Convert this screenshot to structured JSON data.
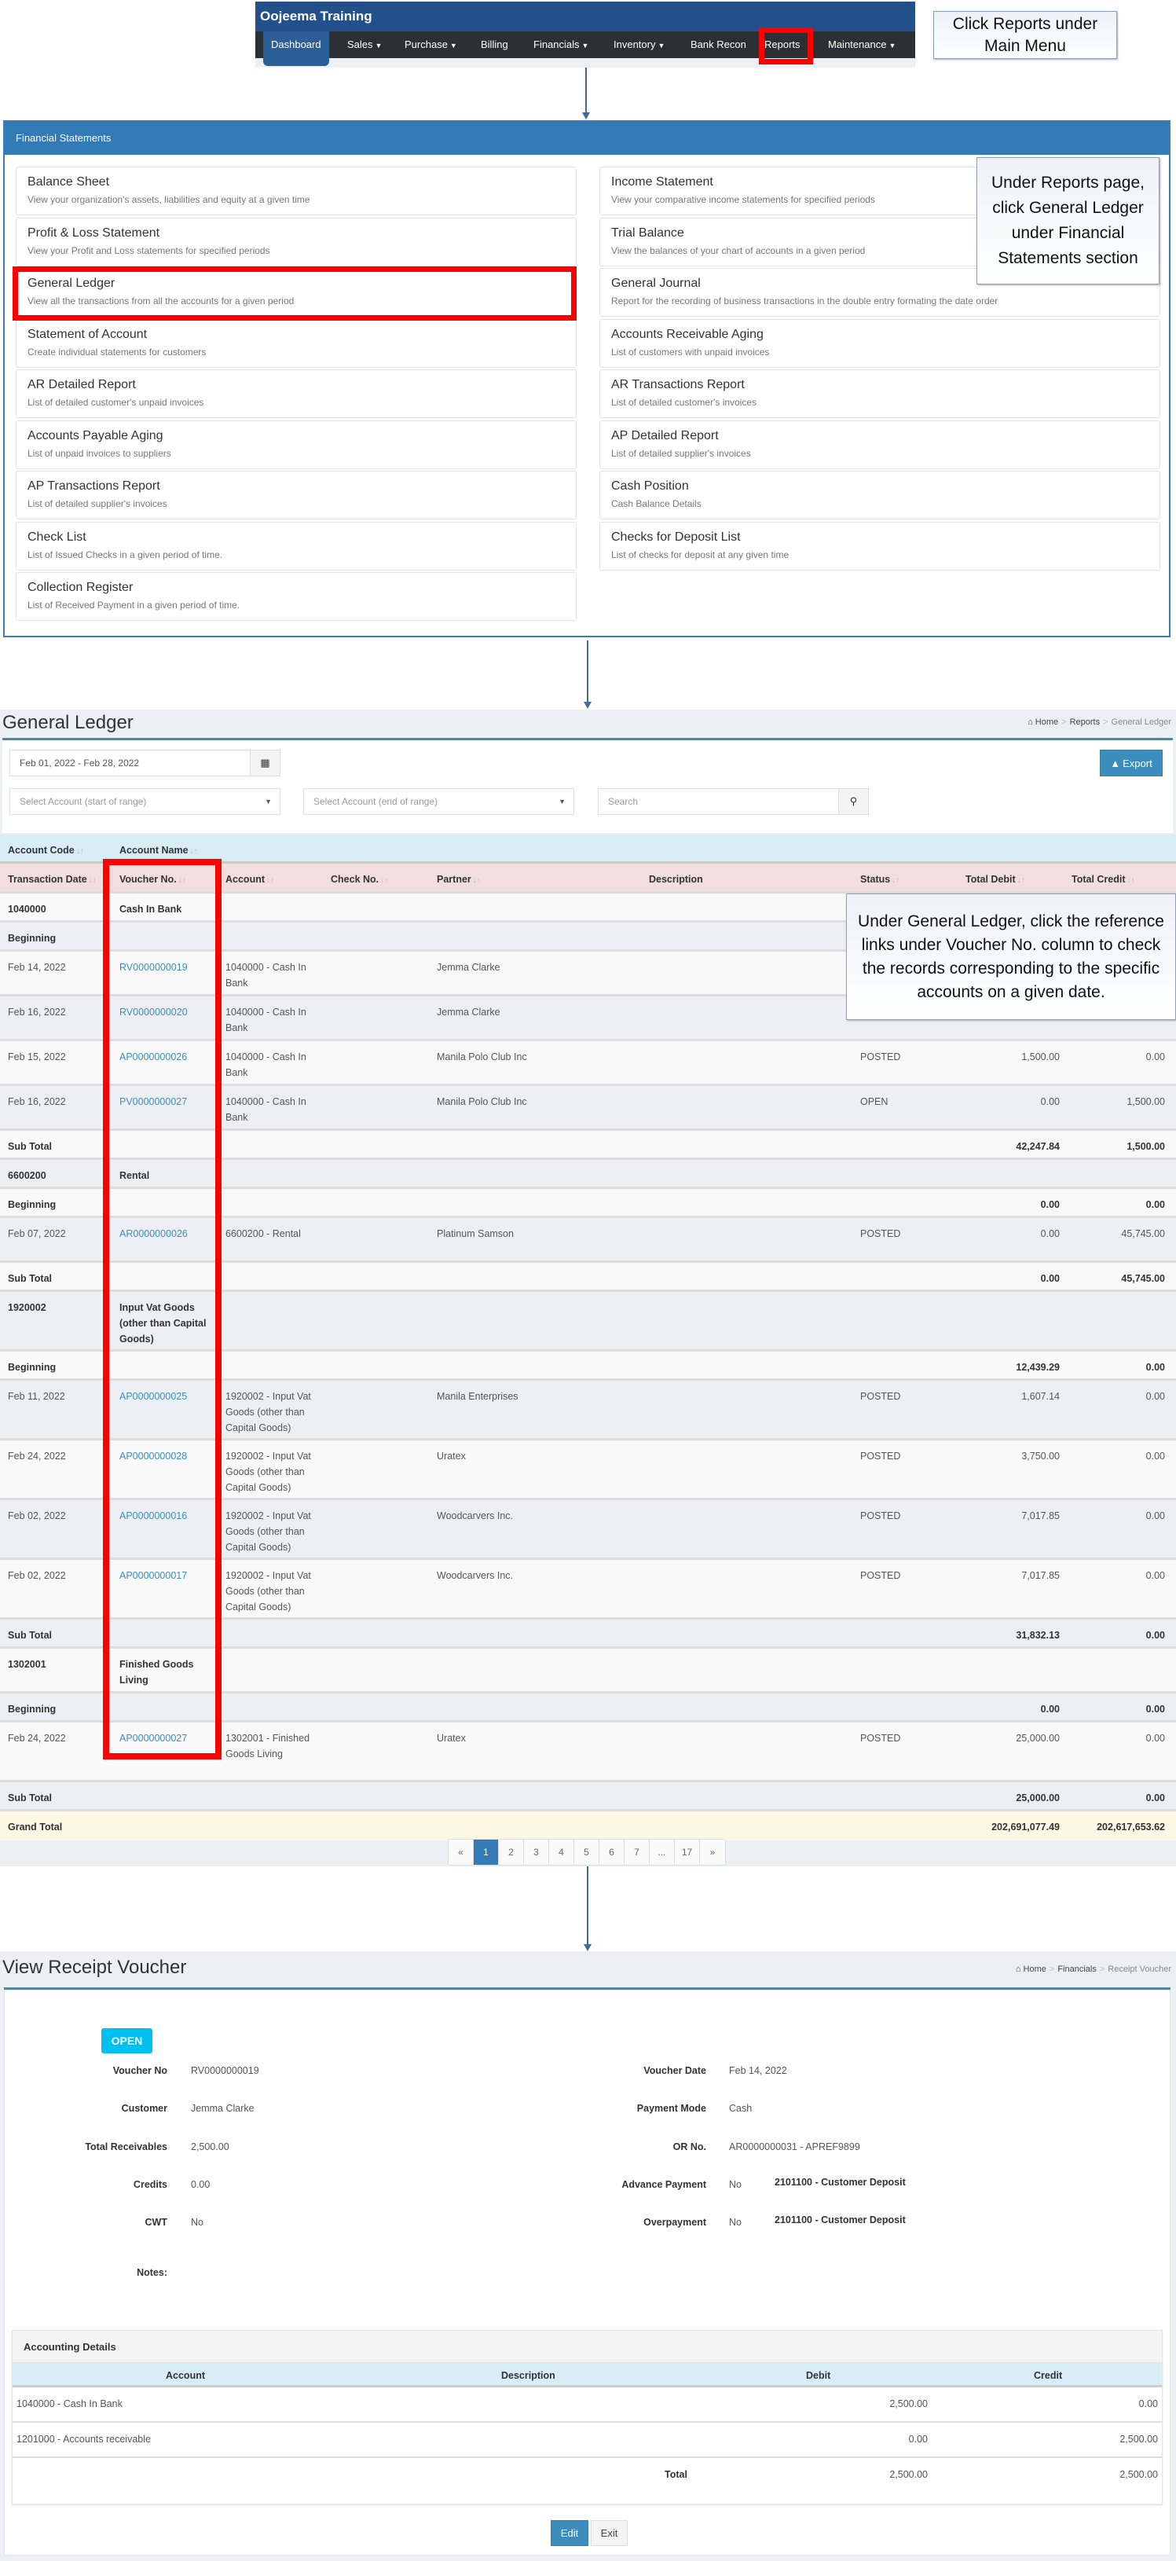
{
  "nav": {
    "app_title": "Oojeema Training",
    "items": [
      {
        "label": "Dashboard",
        "dropdown": false,
        "active": true
      },
      {
        "label": "Sales",
        "dropdown": true
      },
      {
        "label": "Purchase",
        "dropdown": true
      },
      {
        "label": "Billing",
        "dropdown": false
      },
      {
        "label": "Financials",
        "dropdown": true
      },
      {
        "label": "Inventory",
        "dropdown": true
      },
      {
        "label": "Bank Recon",
        "dropdown": false
      },
      {
        "label": "Reports",
        "dropdown": false,
        "highlighted": true
      },
      {
        "label": "Maintenance",
        "dropdown": true
      }
    ]
  },
  "callouts": {
    "step1": "Click Reports under Main Menu",
    "step2": "Under Reports page, click General Ledger under Financial Statements section",
    "step3": "Under General Ledger, click the reference links under Voucher No. column to check the records corresponding to the specific accounts on a given date."
  },
  "reports": {
    "section_title": "Financial Statements",
    "left": [
      {
        "title": "Balance Sheet",
        "desc": "View your organization's assets, liabilities and equity at a given time"
      },
      {
        "title": "Profit & Loss Statement",
        "desc": "View your Profit and Loss statements for specified periods"
      },
      {
        "title": "General Ledger",
        "desc": "View all the transactions from all the accounts for a given period",
        "highlighted": true
      },
      {
        "title": "Statement of Account",
        "desc": "Create individual statements for customers"
      },
      {
        "title": "AR Detailed Report",
        "desc": "List of detailed customer's unpaid invoices"
      },
      {
        "title": "Accounts Payable Aging",
        "desc": "List of unpaid invoices to suppliers"
      },
      {
        "title": "AP Transactions Report",
        "desc": "List of detailed supplier's invoices"
      },
      {
        "title": "Check List",
        "desc": "List of Issued Checks in a given period of time."
      },
      {
        "title": "Collection Register",
        "desc": "List of Received Payment in a given period of time."
      }
    ],
    "right": [
      {
        "title": "Income Statement",
        "desc": "View your comparative income statements for specified periods"
      },
      {
        "title": "Trial Balance",
        "desc": "View the balances of your chart of accounts in a given period"
      },
      {
        "title": "General Journal",
        "desc": "Report for the recording of business transactions in the double entry formating the date order"
      },
      {
        "title": "Accounts Receivable Aging",
        "desc": "List of customers with unpaid invoices"
      },
      {
        "title": "AR Transactions Report",
        "desc": "List of detailed customer's invoices"
      },
      {
        "title": "AP Detailed Report",
        "desc": "List of detailed supplier's invoices"
      },
      {
        "title": "Cash Position",
        "desc": "Cash Balance Details"
      },
      {
        "title": "Checks for Deposit List",
        "desc": "List of checks for deposit at any given time"
      }
    ]
  },
  "ledger": {
    "title": "General Ledger",
    "breadcrumb": [
      "Home",
      "Reports",
      "General Ledger"
    ],
    "date_range": "Feb 01, 2022 - Feb 28, 2022",
    "account_start_placeholder": "Select Account (start of range)",
    "account_end_placeholder": "Select Account (end of range)",
    "search_placeholder": "Search",
    "export_label": "Export",
    "group_headers": [
      "Account Code",
      "Account Name"
    ],
    "headers": [
      "Transaction Date",
      "Voucher No.",
      "Account",
      "Check No.",
      "Partner",
      "Description",
      "Status",
      "Total Debit",
      "Total Credit"
    ],
    "rows": [
      {
        "type": "account",
        "code": "1040000",
        "name": "Cash In Bank"
      },
      {
        "type": "beginning",
        "label": "Beginning",
        "debit": "",
        "credit": ""
      },
      {
        "type": "txn",
        "date": "Feb 14, 2022",
        "voucher": "RV0000000019",
        "account": "1040000 - Cash In Bank",
        "check": "",
        "partner": "Jemma Clarke",
        "description": "",
        "status": "",
        "debit": "",
        "credit": ""
      },
      {
        "type": "txn",
        "date": "Feb 16, 2022",
        "voucher": "RV0000000020",
        "account": "1040000 - Cash In Bank",
        "check": "",
        "partner": "Jemma Clarke",
        "description": "",
        "status": "",
        "debit": "",
        "credit": ""
      },
      {
        "type": "txn",
        "date": "Feb 15, 2022",
        "voucher": "AP0000000026",
        "account": "1040000 - Cash In Bank",
        "check": "",
        "partner": "Manila Polo Club Inc",
        "description": "",
        "status": "POSTED",
        "debit": "1,500.00",
        "credit": "0.00"
      },
      {
        "type": "txn",
        "date": "Feb 16, 2022",
        "voucher": "PV0000000027",
        "account": "1040000 - Cash In Bank",
        "check": "",
        "partner": "Manila Polo Club Inc",
        "description": "",
        "status": "OPEN",
        "debit": "0.00",
        "credit": "1,500.00"
      },
      {
        "type": "subtotal",
        "label": "Sub Total",
        "debit": "42,247.84",
        "credit": "1,500.00"
      },
      {
        "type": "account",
        "code": "6600200",
        "name": "Rental"
      },
      {
        "type": "beginning",
        "label": "Beginning",
        "debit": "0.00",
        "credit": "0.00"
      },
      {
        "type": "txn",
        "date": "Feb 07, 2022",
        "voucher": "AR0000000026",
        "account": "6600200 - Rental",
        "check": "",
        "partner": "Platinum Samson",
        "description": "",
        "status": "POSTED",
        "debit": "0.00",
        "credit": "45,745.00"
      },
      {
        "type": "subtotal",
        "label": "Sub Total",
        "debit": "0.00",
        "credit": "45,745.00"
      },
      {
        "type": "account",
        "code": "1920002",
        "name": "Input Vat Goods (other than Capital Goods)"
      },
      {
        "type": "beginning",
        "label": "Beginning",
        "debit": "12,439.29",
        "credit": "0.00"
      },
      {
        "type": "txn",
        "date": "Feb 11, 2022",
        "voucher": "AP0000000025",
        "account": "1920002 - Input Vat Goods (other than Capital Goods)",
        "check": "",
        "partner": "Manila Enterprises",
        "description": "",
        "status": "POSTED",
        "debit": "1,607.14",
        "credit": "0.00"
      },
      {
        "type": "txn",
        "date": "Feb 24, 2022",
        "voucher": "AP0000000028",
        "account": "1920002 - Input Vat Goods (other than Capital Goods)",
        "check": "",
        "partner": "Uratex",
        "description": "",
        "status": "POSTED",
        "debit": "3,750.00",
        "credit": "0.00"
      },
      {
        "type": "txn",
        "date": "Feb 02, 2022",
        "voucher": "AP0000000016",
        "account": "1920002 - Input Vat Goods (other than Capital Goods)",
        "check": "",
        "partner": "Woodcarvers Inc.",
        "description": "",
        "status": "POSTED",
        "debit": "7,017.85",
        "credit": "0.00"
      },
      {
        "type": "txn",
        "date": "Feb 02, 2022",
        "voucher": "AP0000000017",
        "account": "1920002 - Input Vat Goods (other than Capital Goods)",
        "check": "",
        "partner": "Woodcarvers Inc.",
        "description": "",
        "status": "POSTED",
        "debit": "7,017.85",
        "credit": "0.00"
      },
      {
        "type": "subtotal",
        "label": "Sub Total",
        "debit": "31,832.13",
        "credit": "0.00"
      },
      {
        "type": "account",
        "code": "1302001",
        "name": "Finished Goods Living"
      },
      {
        "type": "beginning",
        "label": "Beginning",
        "debit": "0.00",
        "credit": "0.00"
      },
      {
        "type": "txn",
        "date": "Feb 24, 2022",
        "voucher": "AP0000000027",
        "account": "1302001 - Finished Goods Living",
        "check": "",
        "partner": "Uratex",
        "description": "",
        "status": "POSTED",
        "debit": "25,000.00",
        "credit": "0.00"
      },
      {
        "type": "subtotal",
        "label": "Sub Total",
        "debit": "25,000.00",
        "credit": "0.00"
      },
      {
        "type": "grand",
        "label": "Grand Total",
        "debit": "202,691,077.49",
        "credit": "202,617,653.62"
      }
    ],
    "pagination": {
      "prev": "«",
      "pages": [
        "1",
        "2",
        "3",
        "4",
        "5",
        "6",
        "7",
        "...",
        "17"
      ],
      "next": "»",
      "current": "1"
    }
  },
  "voucher": {
    "title": "View Receipt Voucher",
    "breadcrumb": [
      "Home",
      "Financials",
      "Receipt Voucher"
    ],
    "status_badge": "OPEN",
    "status_color": "#00c0ef",
    "left_fields": [
      {
        "label": "Voucher No",
        "value": "RV0000000019"
      },
      {
        "label": "Customer",
        "value": "Jemma Clarke"
      },
      {
        "label": "Total Receivables",
        "value": "2,500.00"
      },
      {
        "label": "Credits",
        "value": "0.00"
      },
      {
        "label": "CWT",
        "value": "No"
      }
    ],
    "right_fields": [
      {
        "label": "Voucher Date",
        "value": "Feb 14, 2022",
        "extra": ""
      },
      {
        "label": "Payment Mode",
        "value": "Cash",
        "extra": ""
      },
      {
        "label": "OR No.",
        "value": "AR0000000031 - APREF9899",
        "extra": ""
      },
      {
        "label": "Advance Payment",
        "value": "No",
        "extra": "2101100 - Customer Deposit"
      },
      {
        "label": "Overpayment",
        "value": "No",
        "extra": "2101100 - Customer Deposit"
      }
    ],
    "notes_label": "Notes:",
    "accounting": {
      "title": "Accounting Details",
      "headers": [
        "Account",
        "Description",
        "Debit",
        "Credit"
      ],
      "rows": [
        {
          "account": "1040000 - Cash In Bank",
          "description": "",
          "debit": "2,500.00",
          "credit": "0.00"
        },
        {
          "account": "1201000 - Accounts receivable",
          "description": "",
          "debit": "0.00",
          "credit": "2,500.00"
        }
      ],
      "total_label": "Total",
      "total_debit": "2,500.00",
      "total_credit": "2,500.00"
    },
    "edit_label": "Edit",
    "exit_label": "Exit"
  }
}
